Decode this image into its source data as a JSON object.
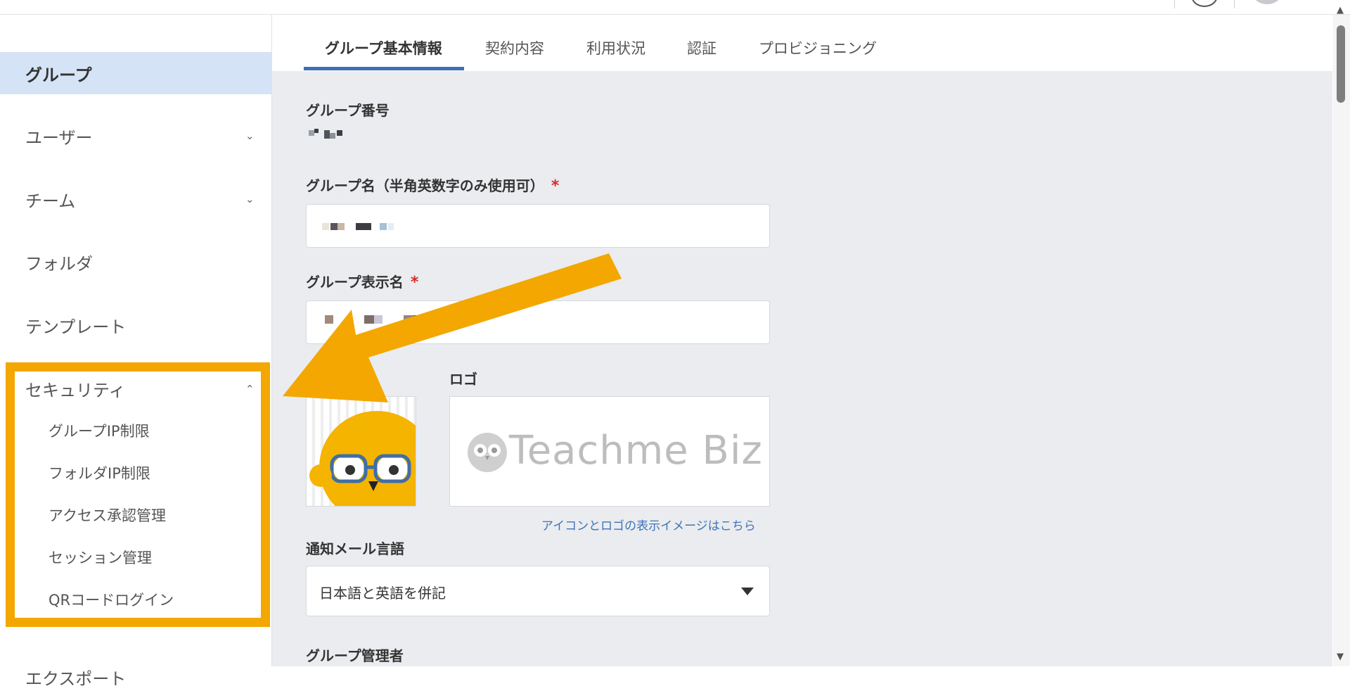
{
  "sidebar": {
    "items": [
      {
        "label": "グループ",
        "active": true
      },
      {
        "label": "ユーザー",
        "chevron": "chevron-down-icon"
      },
      {
        "label": "チーム",
        "chevron": "chevron-down-icon"
      },
      {
        "label": "フォルダ"
      },
      {
        "label": "テンプレート"
      },
      {
        "label": "セキュリティ",
        "chevron": "chevron-up-icon"
      },
      {
        "label": "エクスポート"
      }
    ],
    "security_sub": [
      "グループIP制限",
      "フォルダIP制限",
      "アクセス承認管理",
      "セッション管理",
      "QRコードログイン"
    ],
    "chevron_down": "⌄",
    "chevron_up": "⌃"
  },
  "tabs": [
    "グループ基本情報",
    "契約内容",
    "利用状況",
    "認証",
    "プロビジョニング"
  ],
  "form": {
    "group_number_label": "グループ番号",
    "group_name_label": "グループ名（半角英数字のみ使用可）",
    "display_name_label": "グループ表示名",
    "required_mark": "*",
    "logo_label": "ロゴ",
    "logo_text": "Teachme Biz",
    "preview_link": "アイコンとロゴの表示イメージはこちら",
    "mail_lang_label": "通知メール言語",
    "mail_lang_value": "日本語と英語を併記",
    "admin_label": "グループ管理者"
  },
  "colors": {
    "highlight": "#f3a700",
    "active_tab": "#3e6fb5",
    "active_sidebar": "#d5e3f6",
    "required": "#d62c2c",
    "link": "#3e74b8"
  }
}
